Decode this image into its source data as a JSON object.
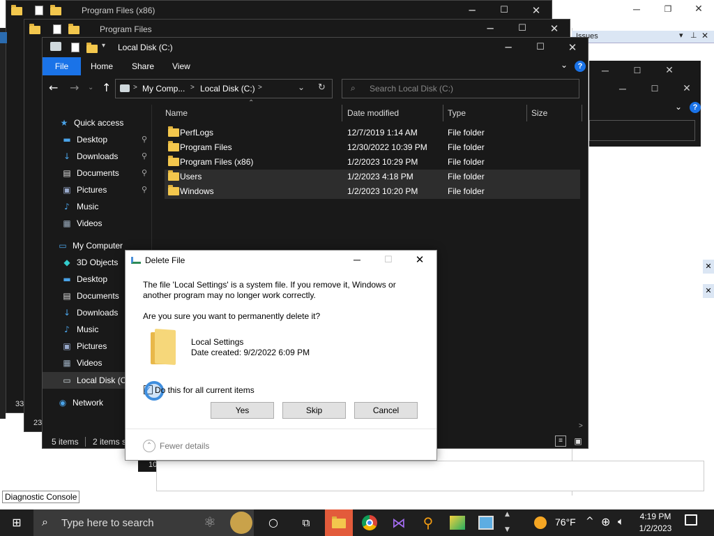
{
  "windows": {
    "back1": {
      "title": "Program Files (x86)"
    },
    "back2": {
      "title": "Program Files"
    },
    "main": {
      "title": "Local Disk (C:)"
    }
  },
  "ribbon": {
    "tabs": [
      "File",
      "Home",
      "Share",
      "View"
    ]
  },
  "address": {
    "crumbs": [
      "My Comp...",
      "Local Disk (C:)"
    ],
    "search_placeholder": "Search Local Disk (C:)"
  },
  "nav": {
    "quick_access": "Quick access",
    "quick_items": [
      "Desktop",
      "Downloads",
      "Documents",
      "Pictures",
      "Music",
      "Videos"
    ],
    "my_computer": "My Computer",
    "computer_items": [
      "3D Objects",
      "Desktop",
      "Documents",
      "Downloads",
      "Music",
      "Pictures",
      "Videos",
      "Local Disk (C"
    ],
    "network": "Network"
  },
  "columns": {
    "name": "Name",
    "date": "Date modified",
    "type": "Type",
    "size": "Size"
  },
  "files": [
    {
      "name": "PerfLogs",
      "date": "12/7/2019 1:14 AM",
      "type": "File folder"
    },
    {
      "name": "Program Files",
      "date": "12/30/2022 10:39 PM",
      "type": "File folder"
    },
    {
      "name": "Program Files (x86)",
      "date": "1/2/2023 10:29 PM",
      "type": "File folder"
    },
    {
      "name": "Users",
      "date": "1/2/2023 4:18 PM",
      "type": "File folder"
    },
    {
      "name": "Windows",
      "date": "1/2/2023 10:20 PM",
      "type": "File folder"
    }
  ],
  "status": {
    "items": "5 items",
    "selected": "2 items s"
  },
  "bg_status": {
    "a": "33",
    "b": "23",
    "c": "10"
  },
  "right_window": {
    "title": "Issues"
  },
  "dialog": {
    "title": "Delete File",
    "message": "The file 'Local Settings' is a system file. If you remove it, Windows or another program may no longer work correctly.",
    "question": "Are you sure you want to permanently delete it?",
    "file_name": "Local Settings",
    "date_created": "Date created: 9/2/2022 6:09 PM",
    "checkbox_label": "Do this for all current items",
    "checkbox_checked": true,
    "yes": "Yes",
    "skip": "Skip",
    "cancel": "Cancel",
    "fewer_details": "Fewer details"
  },
  "diagnostic_console": "Diagnostic Console",
  "taskbar": {
    "search_placeholder": "Type here to search",
    "weather": "76°F",
    "time": "4:19 PM",
    "date": "1/2/2023"
  }
}
